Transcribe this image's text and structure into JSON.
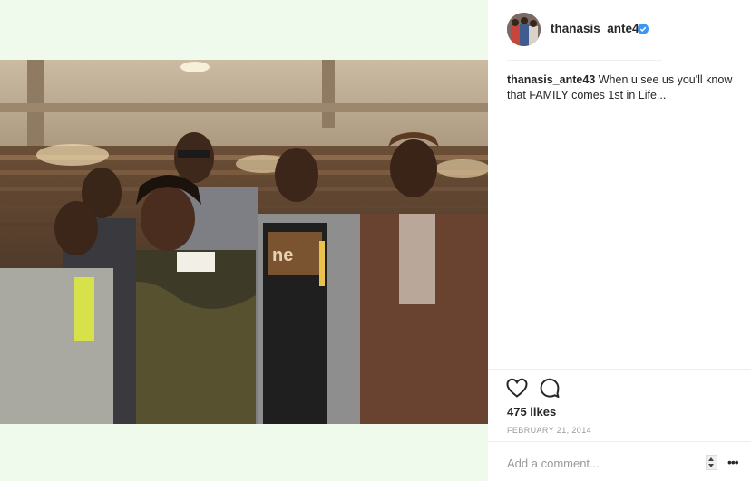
{
  "post": {
    "username": "thanasis_ante43",
    "verified": true,
    "caption_user": "thanasis_ante43",
    "caption_text": " When u see us you'll know that FAMILY comes 1st in Life...",
    "likes": "475 likes",
    "date": "FEBRUARY 21, 2014"
  },
  "comment": {
    "placeholder": "Add a comment..."
  },
  "icons": {
    "like": "heart-icon",
    "comment": "comment-bubble-icon",
    "verified": "verified-badge-icon",
    "more": "more-options-icon"
  },
  "colors": {
    "page_background": "#effaed",
    "verified_badge": "#3897f0",
    "date_text": "#999999"
  }
}
